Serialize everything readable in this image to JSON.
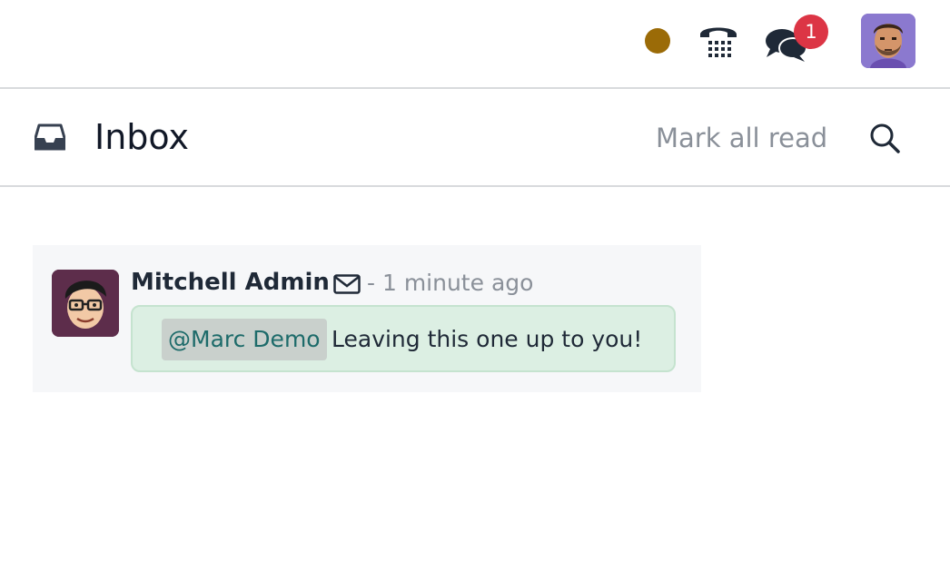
{
  "topbar": {
    "status_color": "#9b6b07",
    "phone_icon": "phone-icon",
    "chat_icon": "chat-bubbles-icon",
    "notification_count": "1",
    "badge_color": "#dc3545",
    "user_avatar": "user-avatar"
  },
  "header": {
    "icon": "inbox-icon",
    "title": "Inbox",
    "mark_all_read": "Mark all read",
    "search_icon": "search-icon"
  },
  "messages": [
    {
      "author": "Mitchell Admin",
      "type_icon": "envelope-icon",
      "timestamp": "- 1 minute ago",
      "mention": "@Marc Demo",
      "body": "Leaving this one up to you!",
      "bubble_color": "#dcefe3"
    }
  ]
}
